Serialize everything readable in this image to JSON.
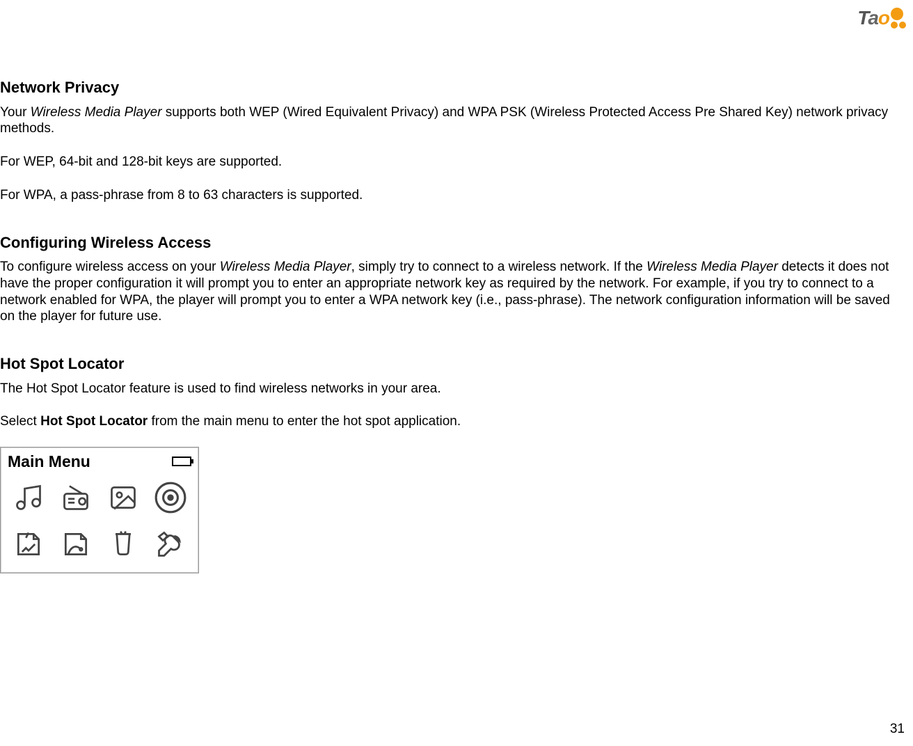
{
  "logo": {
    "text_t": "T",
    "text_a": "a",
    "text_o": "o"
  },
  "sections": {
    "network_privacy": {
      "heading": "Network Privacy",
      "para1_prefix": "Your ",
      "para1_italic": "Wireless Media Player",
      "para1_suffix": " supports both WEP (Wired Equivalent Privacy) and WPA PSK (Wireless Protected Access Pre Shared Key) network privacy methods.",
      "para2": "For WEP, 64-bit and 128-bit keys are supported.",
      "para3": "For WPA, a pass-phrase from 8 to 63 characters is supported."
    },
    "configuring_wireless": {
      "heading": "Configuring Wireless Access",
      "para1_a": "To configure wireless access on your ",
      "para1_b_italic": "Wireless Media Player",
      "para1_c": ", simply try to connect to a wireless network. If the ",
      "para1_d_italic": "Wireless Media Player",
      "para1_e": " detects it does not have the proper configuration it will prompt you to enter an appropriate network key as required by the network. For example, if you try to connect to a network enabled for WPA, the player will prompt you to enter a WPA network key (i.e., pass-phrase).  The network configuration information will be saved on the player for future use."
    },
    "hot_spot_locator": {
      "heading": "Hot Spot Locator",
      "para1": "The Hot Spot Locator feature is used to find wireless networks in your area.",
      "para2_prefix": "Select ",
      "para2_bold": "Hot Spot Locator",
      "para2_suffix": " from the main menu to enter the hot spot application."
    }
  },
  "main_menu_screenshot": {
    "title": "Main Menu",
    "icons": {
      "music": "music-note-icon",
      "radio": "radio-icon",
      "picture": "picture-icon",
      "speaker": "speaker-icon",
      "note": "note-icon",
      "config": "config-icon",
      "cup": "cup-icon",
      "tools": "tools-icon"
    }
  },
  "page_number": "31"
}
